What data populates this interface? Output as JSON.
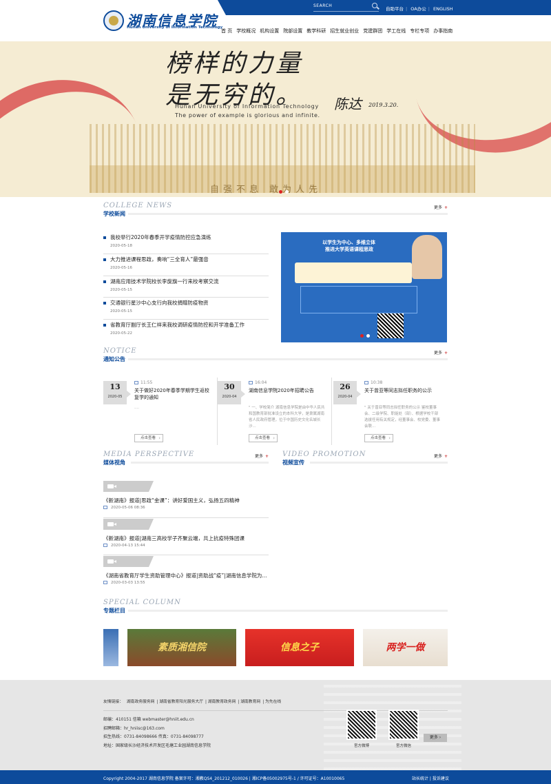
{
  "topbar": {
    "search_label": "SEARCH",
    "links": [
      "自助平台",
      "OA办公",
      "ENGLISH"
    ]
  },
  "logo": {
    "cn": "湖南信息学院",
    "en": "Hunan University of Information Technology"
  },
  "nav": [
    "首 页",
    "学校概况",
    "机构设置",
    "院部设置",
    "教学科研",
    "招生就业创业",
    "党建群团",
    "学工在线",
    "专栏专项",
    "办事指南"
  ],
  "banner": {
    "calligraphy_line1": "榜样的力量",
    "calligraphy_line2": "是无穷的。",
    "signature": "陈达",
    "date": "2019.3.20.",
    "en_line1": "Hunan   University  of  Information  Technology",
    "en_line2": "The  power  of  example  is  glorious  and  infinite.",
    "motto": "自强不息 敢为人先"
  },
  "college_news": {
    "en": "COLLEGE NEWS",
    "cn": "学校新闻",
    "more": "更多",
    "items": [
      {
        "title": "我校举行2020年春季开学疫情防控应急演练",
        "date": "2020-05-18"
      },
      {
        "title": "大力推进课程思政，奏响“三全育人”最强音",
        "date": "2020-05-16"
      },
      {
        "title": "湖南应用技术学院校长李旋旗一行来校考察交流",
        "date": "2020-05-15"
      },
      {
        "title": "交通银行星沙中心支行向我校捐赠防疫物资",
        "date": "2020-05-15"
      },
      {
        "title": "省教育厅副厅长王仁祥来我校调研疫情防控和开学准备工作",
        "date": "2020-05-22"
      }
    ],
    "feature": {
      "line1": "以学生为中心、多维立体",
      "line2": "推进大学英语课程思政"
    }
  },
  "notice": {
    "en": "NOTICE",
    "cn": "通知公告",
    "more": "更多",
    "btn": "点击查看",
    "items": [
      {
        "day": "13",
        "ym": "2020-05",
        "time": "11:55",
        "title": "关于做好2020年春季学期学生返校复学的通知",
        "summary": "...."
      },
      {
        "day": "30",
        "ym": "2020-04",
        "time": "16:04",
        "title": "湖南信息学院2020年招聘公告",
        "summary": "\" 一、学校简介 湖南信息学院是由中华人民共和国教育部批准设立的本科大学，是隶属湖南省人民政府管理，位于中国历史文化名城长沙..."
      },
      {
        "day": "26",
        "ym": "2020-04",
        "time": "10:38",
        "title": "关于曾亚等同志拟任职务的公示",
        "summary": "\" 关于曾亚等同志拟任职务的公示 鉴校董事会、二级学院、职能处（部）、根据学校干部选拔任用有关规定，经董事会、校党委、董事会联..."
      }
    ]
  },
  "media": {
    "en": "MEDIA PERSPECTIVE",
    "cn": "媒体视角",
    "more": "更多",
    "items": [
      {
        "title": "《新湖南》报道|思政“金课”：讲好爱国主义，弘扬五四精神",
        "date": "2020-05-06 08:36"
      },
      {
        "title": "《新湖南》报道|湖南三高校学子齐聚云端，共上抗疫特殊团课",
        "date": "2020-04-13 15:44"
      },
      {
        "title": "《湖南省教育厅学生资助管理中心》报道|资助战“疫”|湖南信息学院为...",
        "date": "2020-03-03 13:55"
      }
    ]
  },
  "video": {
    "en": "VIDEO PROMOTION",
    "cn": "视频宣传",
    "more": "更多"
  },
  "special": {
    "en": "SPECIAL COLUMN",
    "cn": "专题栏目",
    "items": [
      "素质湘信院",
      "信息之子",
      "两学一做"
    ]
  },
  "footer": {
    "links_label": "友情链接：",
    "links": [
      "湖南政务服务网",
      "湖南省教育阳光服务大厅",
      "湖南教育政务网",
      "湖南教育网",
      "为先在线"
    ],
    "info": [
      "邮编：410151  信箱 webmaster@hniit.edu.cn",
      "招聘邮箱：hr_hniisc@163.com",
      "招生热线：0731-84098666  传真：0731-84098777",
      "地址：国家级长沙经济技术开发区毛塘工业园湖南信息学院"
    ],
    "qr1": "官方微博",
    "qr2": "官方微信",
    "more": "更多 ›",
    "copyright": "Copyright 2004-2017 湖南信息学院 备案许可：湘教QS4_201212_010026 | 湘ICP备05002975号-1 / 许可证号：A10010065",
    "right_links": "站长统计 | 投诉建议"
  },
  "colors": {
    "brand_blue": "#0d4b9b",
    "accent_red": "#cc3333"
  }
}
